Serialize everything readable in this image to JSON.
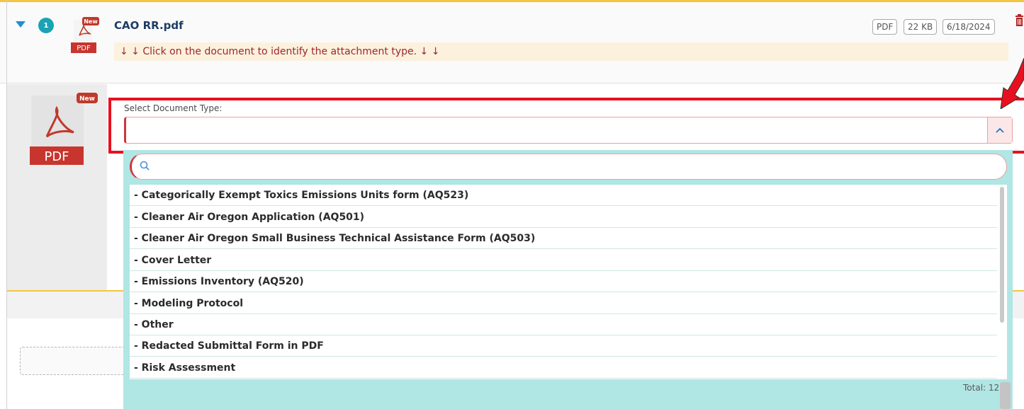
{
  "attachment": {
    "count_badge": "1",
    "new_badge": "New",
    "file_icon_label": "PDF",
    "file_name": "CAO RR.pdf",
    "hint": "↓ ↓ Click on the document to identify the attachment type. ↓ ↓",
    "meta": {
      "type": "PDF",
      "size": "22 KB",
      "date": "6/18/2024"
    }
  },
  "preview": {
    "new_badge": "New",
    "file_icon_label": "PDF"
  },
  "document_type": {
    "label": "Select Document Type:",
    "value": "",
    "toggle_icon": "chevron-up-icon"
  },
  "dropdown": {
    "search_value": "",
    "options": [
      "- Categorically Exempt Toxics Emissions Units form (AQ523)",
      "- Cleaner Air Oregon Application (AQ501)",
      "- Cleaner Air Oregon Small Business Technical Assistance Form (AQ503)",
      "- Cover Letter",
      "- Emissions Inventory (AQ520)",
      "- Modeling Protocol",
      "- Other",
      "- Redacted Submittal Form in PDF",
      "- Risk Assessment"
    ],
    "total": "Total: 12"
  },
  "colors": {
    "accent_yellow": "#f4c542",
    "annotation_red": "#e8101f",
    "dropdown_teal": "#b0e6e4",
    "badge_teal": "#1aa3b5",
    "file_name_navy": "#1d3b66"
  }
}
